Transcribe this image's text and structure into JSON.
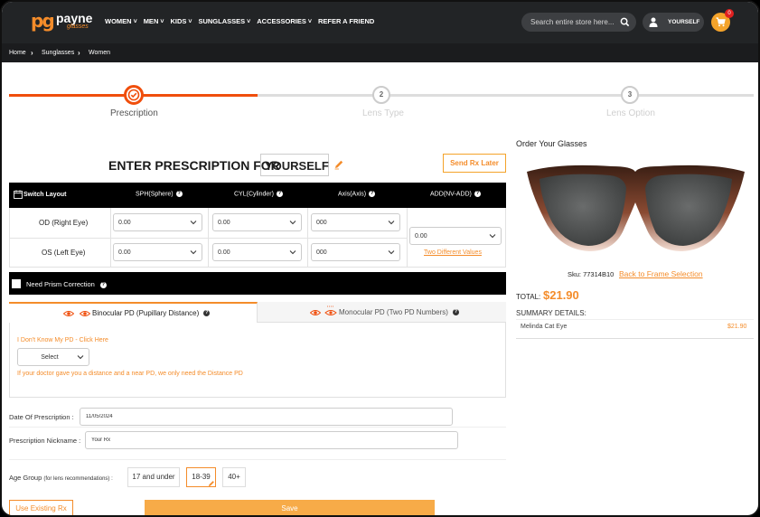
{
  "header": {
    "logo_mark": "pg",
    "logo_brand": "payne",
    "logo_sub": "glasses",
    "nav": [
      "WOMEN",
      "MEN",
      "KIDS",
      "SUNGLASSES",
      "ACCESSORIES",
      "REFER A FRIEND"
    ],
    "nav_has_dropdown": [
      true,
      true,
      true,
      true,
      true,
      false
    ],
    "search_placeholder": "Search entire store here...",
    "user_label": "YOURSELF",
    "cart_count": "0"
  },
  "breadcrumb": [
    "Home",
    "Sunglasses",
    "Women"
  ],
  "steps": [
    {
      "number": "1",
      "label": "Prescription",
      "state": "done"
    },
    {
      "number": "2",
      "label": "Lens Type",
      "state": "pending"
    },
    {
      "number": "3",
      "label": "Lens Option",
      "state": "pending"
    }
  ],
  "rx": {
    "title": "ENTER PRESCRIPTION FOR",
    "who": "YOURSELF",
    "send_later": "Send Rx Later",
    "switch_layout": "Switch Layout",
    "columns": [
      "SPH(Sphere)",
      "CYL(Cylinder)",
      "Axis(Axis)",
      "ADD(NV-ADD)"
    ],
    "rows": [
      {
        "label": "OD (Right Eye)",
        "sph": "0.00",
        "cyl": "0.00",
        "axis": "000"
      },
      {
        "label": "OS (Left Eye)",
        "sph": "0.00",
        "cyl": "0.00",
        "axis": "000"
      }
    ],
    "add_value": "0.00",
    "two_different": "Two Different Values",
    "prism_label": "Need Prism Correction"
  },
  "pd": {
    "tab_binocular": "Binocular PD (Pupillary Distance)",
    "tab_monocular": "Monocular PD (Two PD Numbers)",
    "dont_know": "I Don't Know My PD - Click Here",
    "select_value": "Select",
    "note": "If your doctor gave you a distance and a near PD, we only need the Distance PD"
  },
  "form": {
    "date_label": "Date Of Prescription :",
    "date_value": "11/05/2024",
    "nickname_label": "Prescription Nickname :",
    "nickname_value": "Your Rx",
    "age_label": "Age Group",
    "age_hint": "(for lens recommendations) :",
    "age_options": [
      "17 and under",
      "18-39",
      "40+"
    ],
    "age_selected": "18-39",
    "use_existing": "Use Existing Rx",
    "save": "Save"
  },
  "order": {
    "title": "Order Your Glasses",
    "sku_label": "Sku: 77314B10",
    "back_link": "Back to Frame Selection",
    "total_label": "TOTAL:",
    "total_value": "$21.90",
    "summary_label": "SUMMARY DETAILS:",
    "item_name": "Melinda Cat Eye",
    "item_price": "$21.90"
  },
  "colors": {
    "accent": "#f48c2a",
    "header_bg": "#222426",
    "table_head": "#000000"
  }
}
